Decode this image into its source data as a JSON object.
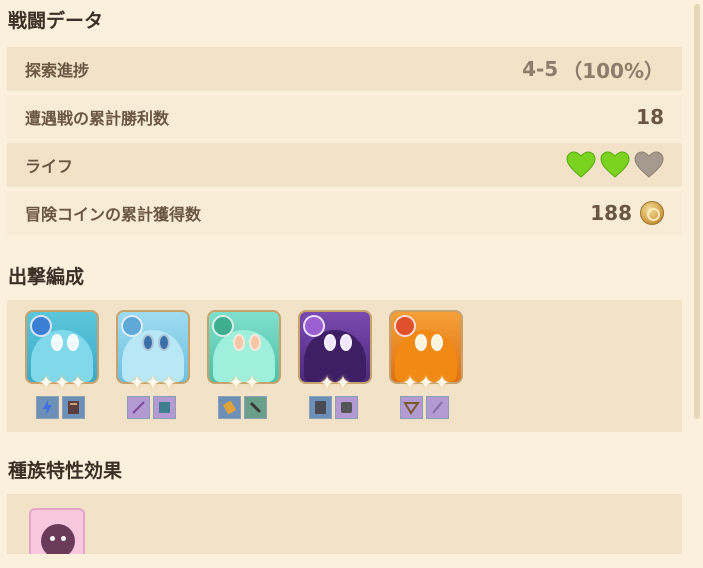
{
  "battle_data": {
    "title": "戦闘データ",
    "rows": [
      {
        "label": "探索進捗",
        "value": "4-5",
        "sub": "（100%）"
      },
      {
        "label": "遭遇戦の累計勝利数",
        "value": "18"
      },
      {
        "label": "ライフ",
        "hearts_total": 3,
        "hearts_filled": 2
      },
      {
        "label": "冒険コインの累計獲得数",
        "value": "188",
        "icon": "coin-icon"
      }
    ]
  },
  "lineup": {
    "title": "出撃編成",
    "slimes": [
      {
        "element": "hydro",
        "elem_icon": "hydro-icon",
        "color": "#4fc0d8",
        "stars": 3,
        "items": [
          "electro-gem-icon",
          "book-icon"
        ]
      },
      {
        "element": "cryo",
        "elem_icon": "cryo-icon",
        "color": "#8fd2ea",
        "stars": 3,
        "items": [
          "sword-icon",
          "spellbook-icon"
        ]
      },
      {
        "element": "anemo",
        "elem_icon": "anemo-icon",
        "color": "#6fd6c2",
        "stars": 2,
        "items": [
          "scroll-icon",
          "dagger-icon"
        ]
      },
      {
        "element": "electro",
        "elem_icon": "electro-icon",
        "color": "#6a3a9a",
        "stars": 2,
        "items": [
          "tome-icon",
          "armor-icon"
        ]
      },
      {
        "element": "pyro",
        "elem_icon": "pyro-icon",
        "color": "#f28a1a",
        "stars": 3,
        "items": [
          "bow-icon",
          "staff-icon"
        ]
      }
    ]
  },
  "traits": {
    "title": "種族特性効果",
    "items": [
      {
        "icon": "slime-trait-icon"
      }
    ]
  }
}
